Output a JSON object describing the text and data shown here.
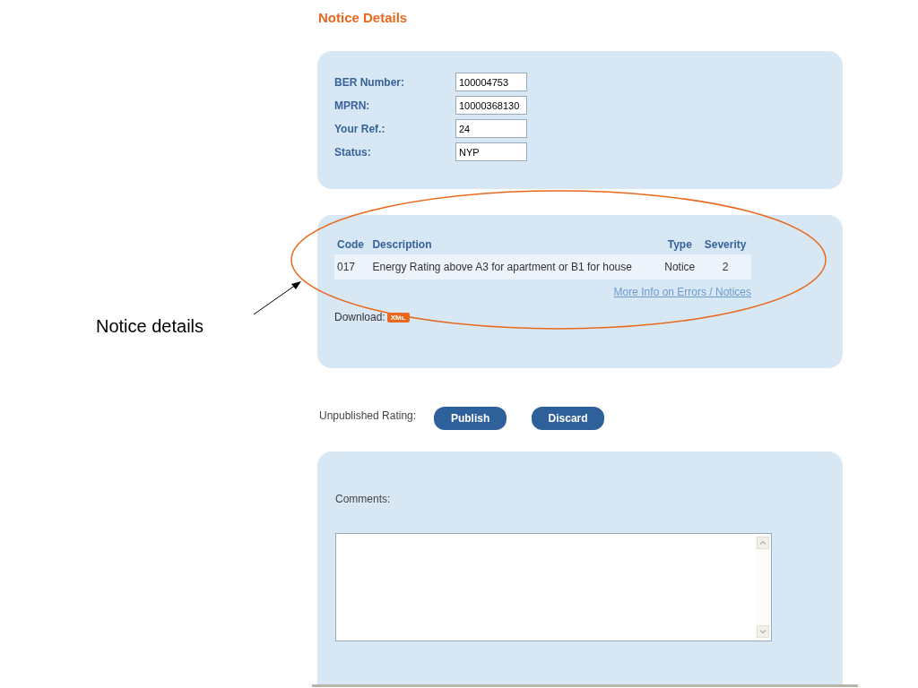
{
  "heading": "Notice Details",
  "fields": [
    {
      "label": "BER Number:",
      "value": "100004753"
    },
    {
      "label": "MPRN:",
      "value": "10000368130"
    },
    {
      "label": "Your Ref.:",
      "value": "24"
    },
    {
      "label": "Status:",
      "value": "NYP"
    }
  ],
  "notices": {
    "columns": [
      "Code",
      "Description",
      "Type",
      "Severity"
    ],
    "rows": [
      [
        "017",
        "Energy Rating above A3 for apartment or B1 for house",
        "Notice",
        "2"
      ]
    ],
    "link": "More Info on Errors / Notices",
    "download_label": "Download:",
    "download_badge": "XML"
  },
  "rating": {
    "label": "Unpublished Rating:",
    "buttons": [
      "Publish",
      "Discard"
    ]
  },
  "comments": {
    "label": "Comments:"
  },
  "callout": "Notice details"
}
